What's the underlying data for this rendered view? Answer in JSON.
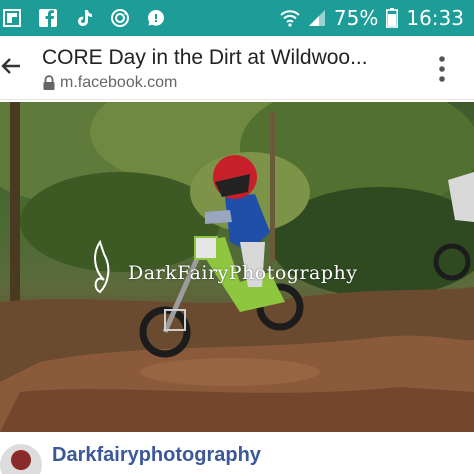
{
  "status_bar": {
    "icons": [
      "flipboard-icon",
      "facebook-icon",
      "tiktok-icon",
      "sync-icon",
      "whatsapp-icon"
    ],
    "battery_percent": "75%",
    "time": "16:33",
    "bg_color": "#1e9c98"
  },
  "browser": {
    "title": "CORE Day in the Dirt at Wildwoo...",
    "url": "m.facebook.com"
  },
  "post": {
    "watermark": "DarkFairyPhotography",
    "author": "Darkfairyphotography",
    "author_color": "#3b5998"
  }
}
